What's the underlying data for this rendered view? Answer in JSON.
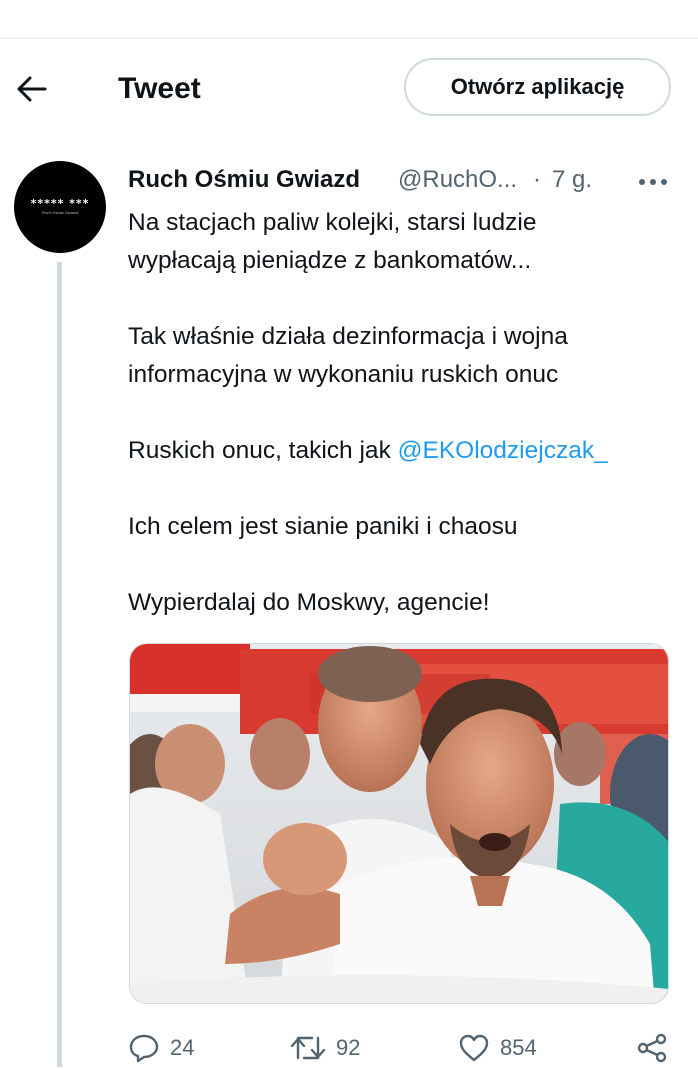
{
  "header": {
    "title": "Tweet",
    "open_app_label": "Otwórz aplikację",
    "back_icon": "arrow-left-icon"
  },
  "tweet": {
    "author_name": "Ruch Ośmiu Gwiazd",
    "author_handle": "@RuchO...",
    "separator": "·",
    "time": "7 g.",
    "avatar_text": "***** ***",
    "avatar_subtext": "Ruch Ośmiu Gwiazd",
    "text": {
      "line1": "Na stacjach paliw kolejki, starsi ludzie",
      "line2": "wypłacają pieniądze z bankomatów...",
      "line3": "Tak właśnie działa dezinformacja i wojna",
      "line4": "informacyjna w wykonaniu ruskich onuc",
      "line5_prefix": "Ruskich onuc, takich jak ",
      "line5_mention": "@EKOlodziejczak_",
      "line6": "Ich celem jest sianie paniki i chaosu",
      "line7": "Wypierdalaj do Moskwy, agencie!"
    },
    "media": {
      "description_icon": "photo-protest-icon"
    },
    "stats": {
      "replies": "24",
      "retweets": "92",
      "likes": "854"
    }
  },
  "colors": {
    "accent": "#1d9bf0",
    "text": "#0f1419",
    "secondary": "#536471",
    "border": "#cfd9de"
  }
}
